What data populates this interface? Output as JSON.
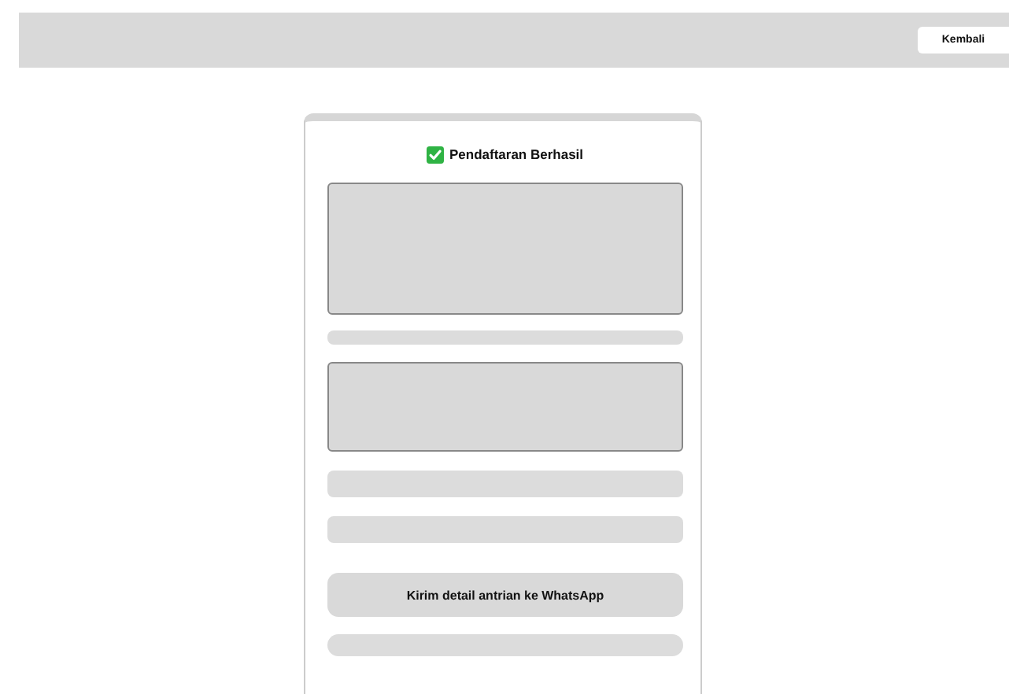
{
  "header": {
    "back_button": "Kembali"
  },
  "card": {
    "title": "Pendaftaran Berhasil",
    "success": true,
    "whatsapp_button": "Kirim detail antrian ke WhatsApp"
  }
}
